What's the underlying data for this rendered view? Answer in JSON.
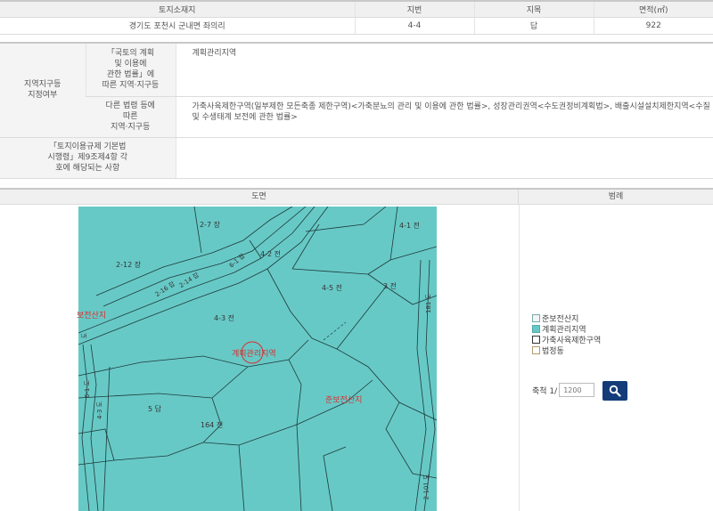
{
  "land": {
    "headers": [
      "토지소재지",
      "지번",
      "지목",
      "면적(㎡)"
    ],
    "row": {
      "location": "경기도 포천시 군내면 좌의리",
      "lot": "4-4",
      "category": "답",
      "area": "922"
    }
  },
  "zoning": {
    "section_label": "지역지구등\n지정여부",
    "row1_label": "「국토의 계획\n및 이용에\n관한 법률」에\n따른 지역·지구등",
    "row1_value": "계획관리지역",
    "row2_label": "다른 법령 등에\n따른\n지역·지구등",
    "row2_value_line1": "가축사육제한구역(일부제한 모든축종 제한구역)<가축분뇨의 관리 및 이용에 관한 법률>, 성장관리권역<수도권정비계획법>, 배출시설설치제한지역<수질",
    "row2_value_line2": "및 수생태계 보전에 관한 법률>",
    "row3_label": "「토지이용규제 기본법\n시행령」제9조제4항 각\n호에 해당되는 사항",
    "row3_value": ""
  },
  "map_section": {
    "map_header": "도면",
    "legend_header": "범례"
  },
  "map": {
    "labels": {
      "l_2_7": "2-7 장",
      "l_4_1": "4-1 전",
      "l_2_12": "2-12 장",
      "l_4_2": "4-2 전",
      "l_4_5": "4-5 전",
      "l_3": "3 전",
      "l_4_3": "4-3 전",
      "l_5": "5 답",
      "l_164": "164 전",
      "l_4_4": "계획관리지역",
      "l_agri": "준보전산지",
      "l_left_red": "보전산지"
    },
    "road_labels": {
      "r1": "2-16 잡",
      "r2": "2-14 잡",
      "r3": "6-1 잡",
      "r4": "181 도",
      "r5": "6-1 도",
      "r6": "4-3 도",
      "r7": "도",
      "r8": "2-101 도"
    }
  },
  "legend": {
    "items": [
      {
        "label": "준보전산지",
        "color": "#f4f4f4",
        "border": "#7aa"
      },
      {
        "label": "계획관리지역",
        "color": "#67c9c6",
        "border": "#5aa"
      },
      {
        "label": "가축사육제한구역",
        "color": "#ffffff",
        "border": "#333"
      },
      {
        "label": "법정동",
        "color": "#ffffff",
        "border": "#b49a6a"
      }
    ]
  },
  "scale": {
    "label": "축척 1/",
    "placeholder": "1200"
  },
  "colors": {
    "map_fill": "#67c9c6",
    "search_button": "#143c78",
    "zone_red": "#d83030"
  }
}
